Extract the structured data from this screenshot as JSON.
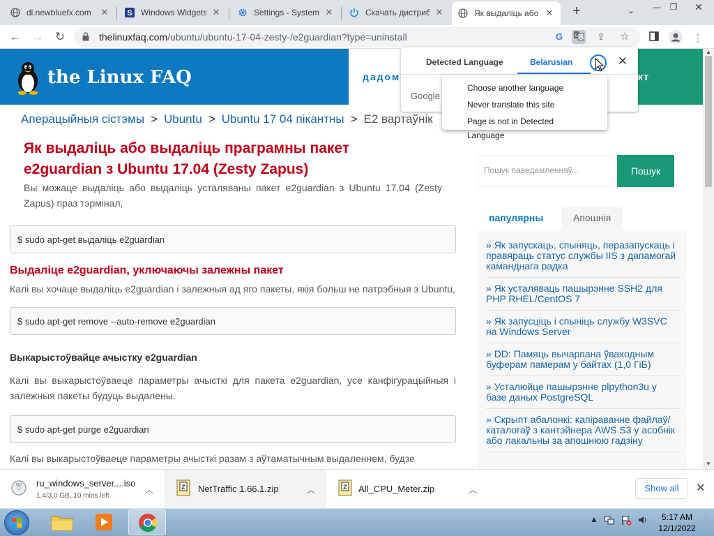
{
  "tabs": [
    {
      "title": "dl.newbluefx.com",
      "icon": "globe-icon"
    },
    {
      "title": "Windows Widgets",
      "icon": "s-logo-icon"
    },
    {
      "title": "Settings - System",
      "icon": "gear-icon"
    },
    {
      "title": "Скачать дистриб",
      "icon": "power-icon"
    },
    {
      "title": "Як выдаліць або",
      "icon": "globe-icon"
    }
  ],
  "omnibox": {
    "domain": "thelinuxfaq.com",
    "path": "/ubuntu/ubuntu-17-04-zesty-/e2guardian?type=uninstall"
  },
  "site": {
    "logo": "the Linux FAQ",
    "menu_partial": "дадом",
    "green_partial": "акт",
    "breadcrumb": [
      "Аперацыйныя сістэмы",
      "Ubuntu",
      "Ubuntu 17 04 пікантны",
      "E2 вартаўнік"
    ],
    "title": "Як выдаліць або выдаліць праграмны пакет e2guardian з Ubuntu 17.04 (Zesty Zapus)",
    "intro": "Вы можаце выдаліць або выдаліць усталяваны пакет e2guardian з Ubuntu 17.04 (Zesty Zapus) праз тэрмінал,",
    "code1": "$ sudo apt-get выдаліць e2guardian",
    "h_deps": "Выдаліце e2guardian, уключаючы залежны пакет",
    "p_deps": "Калі вы хочаце выдаліць e2guardian і залежныя ад яго пакеты, якія больш не патрэбныя з Ubuntu,",
    "code2": "$ sudo apt-get remove --auto-remove e2guardian",
    "h_purge": "Выкарыстоўвайце ачыстку e2guardian",
    "p_purge": "Калі вы выкарыстоўваеце параметры ачысткі для пакета e2guardian, усе канфігурацыйныя і залежныя пакеты будуць выдалены.",
    "code3": "$ sudo apt-get purge e2guardian",
    "p_last": "Калі вы выкарыстоўваеце параметры ачысткі разам з аўтаматычным выдаленнем, будзе"
  },
  "sidebar": {
    "search_placeholder": "Пошук паведамленняў...",
    "search_button": "Пошук",
    "tab_popular": "папулярны",
    "tab_recent": "Апошнія",
    "posts": [
      "Як запускаць, спыняць, перазапускаць і правяраць статус службы IIS з дапамогай каманднага радка",
      "Як усталяваць пашырэнне SSH2 для PHP RHEL/CentOS 7",
      "Як запусціць і спыніць службу W3SVC на Windows Server",
      "DD: Памяць вычарпана ўваходным буферам памерам у байтах (1,0 ГіБ)",
      "Усталюйце пашырэнне plpython3u у базе даных PostgreSQL",
      "Скрыпт абалонкі: капіраванне файлаў/каталогаў з кантэйнера AWS S3 у асобнік або лакальны за апошнюю гадзіну"
    ]
  },
  "translate": {
    "tab_detected": "Detected Language",
    "tab_target": "Belarusian",
    "google_partial": "Google",
    "menu": [
      "Choose another language",
      "Never translate this site",
      "Page is not in Detected Language"
    ]
  },
  "downloads": [
    {
      "name": "ru_windows_server....iso",
      "status": "1.4/3.0 GB, 10 mins left"
    },
    {
      "name": "NetTraffic 1.66.1.zip",
      "status": ""
    },
    {
      "name": "All_CPU_Meter.zip",
      "status": ""
    }
  ],
  "shelf": {
    "show_all": "Show all"
  },
  "clock": {
    "time": "5:17 AM",
    "date": "12/1/2022"
  },
  "colors": {
    "brand_blue": "#0e78c0",
    "brand_green": "#1a9977",
    "title_red": "#c0001a",
    "link_blue": "#1565a8"
  }
}
